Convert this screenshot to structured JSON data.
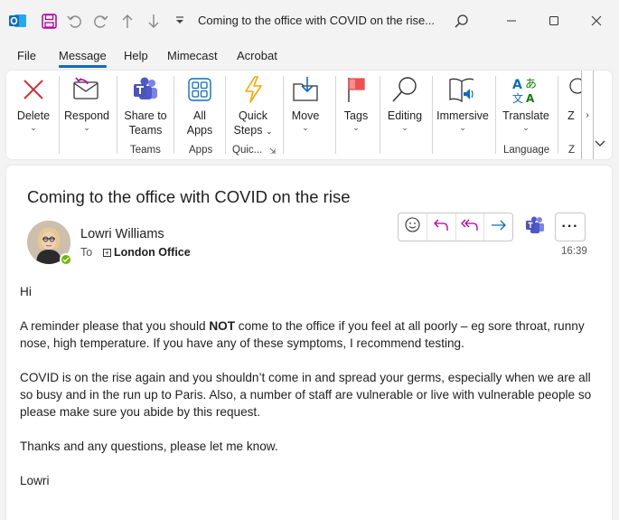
{
  "titlebar": {
    "title": "Coming to the office with COVID on the rise...",
    "icons": [
      "outlook-icon",
      "save-icon",
      "undo-icon",
      "redo-icon",
      "up-icon",
      "down-icon",
      "quick-access-dropdown-icon",
      "search-icon",
      "minimize-icon",
      "maximize-icon",
      "close-icon"
    ]
  },
  "menu": {
    "tabs": [
      "File",
      "Message",
      "Help",
      "Mimecast",
      "Acrobat"
    ],
    "active": "Message",
    "accent": "#0f6cbd"
  },
  "ribbon": {
    "delete": "Delete",
    "respond": "Respond",
    "share_line1": "Share to",
    "share_line2": "Teams",
    "all_apps_line1": "All",
    "all_apps_line2": "Apps",
    "quick_line1": "Quick",
    "quick_line2": "Steps",
    "move": "Move",
    "tags": "Tags",
    "editing": "Editing",
    "immersive": "Immersive",
    "translate": "Translate",
    "zoom_partial": "Z",
    "groups": {
      "teams": "Teams",
      "apps": "Apps",
      "quick": "Quic...",
      "language": "Language",
      "zoom": "Z"
    }
  },
  "message": {
    "subject": "Coming to the office with COVID on the rise",
    "sender": "Lowri Williams",
    "to_label": "To",
    "recipient": "London Office",
    "time": "16:39",
    "presence_color": "#6bb700",
    "body": {
      "greeting": "Hi",
      "p1_before": "A reminder please that you should ",
      "p1_bold": "NOT",
      "p1_after": " come to the office if you feel at all poorly – eg sore throat, runny nose, high temperature. If you have any of these symptoms, I recommend testing.",
      "p2": "COVID is on the rise again and you shouldn’t come in and spread your germs, especially when we are all so busy and in the run up to Paris. Also, a number of staff are vulnerable or live with vulnerable people so please make sure you abide by this request.",
      "p3": "Thanks and any questions, please let me know.",
      "signoff": "Lowri"
    }
  }
}
